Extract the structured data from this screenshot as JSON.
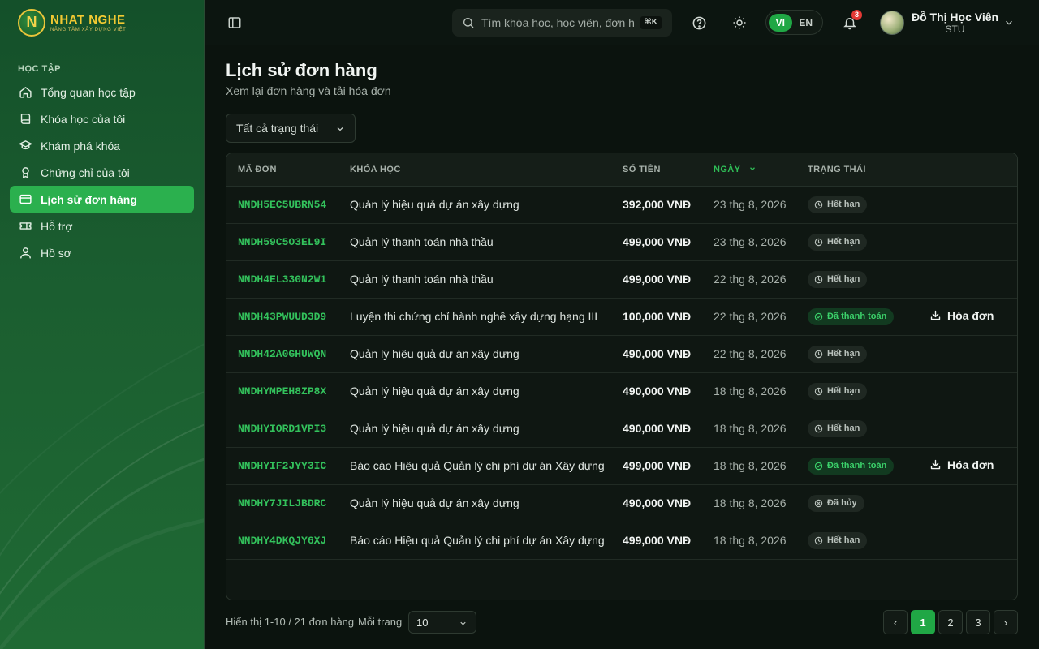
{
  "brand": {
    "name": "NHAT NGHE",
    "tagline": "NÂNG TẦM XÂY DỰNG VIỆT",
    "primary_color": "#20a745",
    "accent_color": "#f2c932"
  },
  "sidebar": {
    "section_label": "HỌC TẬP",
    "items": [
      {
        "label": "Tổng quan học tập",
        "icon": "home-icon",
        "active": false
      },
      {
        "label": "Khóa học của tôi",
        "icon": "book-icon",
        "active": false
      },
      {
        "label": "Khám phá khóa",
        "icon": "graduation-cap-icon",
        "active": false
      },
      {
        "label": "Chứng chỉ của tôi",
        "icon": "award-icon",
        "active": false
      },
      {
        "label": "Lịch sử đơn hàng",
        "icon": "credit-card-icon",
        "active": true
      },
      {
        "label": "Hỗ trợ",
        "icon": "ticket-icon",
        "active": false
      },
      {
        "label": "Hồ sơ",
        "icon": "user-icon",
        "active": false
      }
    ]
  },
  "header": {
    "search_placeholder": "Tìm khóa học, học viên, đơn h",
    "search_shortcut": "⌘K",
    "languages": [
      "VI",
      "EN"
    ],
    "active_language": "VI",
    "notification_count": "3",
    "user_name": "Đỗ Thị Học Viên",
    "user_role": "STU"
  },
  "main": {
    "title": "Lịch sử đơn hàng",
    "subtitle": "Xem lại đơn hàng và tải hóa đơn",
    "filter_value": "Tất cả trạng thái",
    "table": {
      "columns": [
        "MÃ ĐƠN",
        "KHÓA HỌC",
        "SỐ TIỀN",
        "NGÀY",
        "TRẠNG THÁI"
      ],
      "sorted_column": "NGÀY",
      "invoice_label": "Hóa đơn",
      "rows": [
        {
          "code": "NNDH5EC5UBRN54",
          "course": "Quản lý hiệu quả dự án xây dựng",
          "amount": "392,000 VNĐ",
          "date": "23 thg 8, 2026",
          "status": "Hết hạn",
          "status_type": "expired",
          "has_invoice": false
        },
        {
          "code": "NNDH59C5O3EL9I",
          "course": "Quản lý thanh toán nhà thầu",
          "amount": "499,000 VNĐ",
          "date": "23 thg 8, 2026",
          "status": "Hết hạn",
          "status_type": "expired",
          "has_invoice": false
        },
        {
          "code": "NNDH4EL330N2W1",
          "course": "Quản lý thanh toán nhà thầu",
          "amount": "499,000 VNĐ",
          "date": "22 thg 8, 2026",
          "status": "Hết hạn",
          "status_type": "expired",
          "has_invoice": false
        },
        {
          "code": "NNDH43PWUUD3D9",
          "course": "Luyện thi chứng chỉ hành nghề xây dựng hạng III",
          "amount": "100,000 VNĐ",
          "date": "22 thg 8, 2026",
          "status": "Đã thanh toán",
          "status_type": "paid",
          "has_invoice": true
        },
        {
          "code": "NNDH42A0GHUWQN",
          "course": "Quản lý hiệu quả dự án xây dựng",
          "amount": "490,000 VNĐ",
          "date": "22 thg 8, 2026",
          "status": "Hết hạn",
          "status_type": "expired",
          "has_invoice": false
        },
        {
          "code": "NNDHYMPEH8ZP8X",
          "course": "Quản lý hiệu quả dự án xây dựng",
          "amount": "490,000 VNĐ",
          "date": "18 thg 8, 2026",
          "status": "Hết hạn",
          "status_type": "expired",
          "has_invoice": false
        },
        {
          "code": "NNDHYIORD1VPI3",
          "course": "Quản lý hiệu quả dự án xây dựng",
          "amount": "490,000 VNĐ",
          "date": "18 thg 8, 2026",
          "status": "Hết hạn",
          "status_type": "expired",
          "has_invoice": false
        },
        {
          "code": "NNDHYIF2JYY3IC",
          "course": "Báo cáo Hiệu quả Quản lý chi phí dự án Xây dựng",
          "amount": "499,000 VNĐ",
          "date": "18 thg 8, 2026",
          "status": "Đã thanh toán",
          "status_type": "paid",
          "has_invoice": true
        },
        {
          "code": "NNDHY7JILJBDRC",
          "course": "Quản lý hiệu quả dự án xây dựng",
          "amount": "490,000 VNĐ",
          "date": "18 thg 8, 2026",
          "status": "Đã hủy",
          "status_type": "cancelled",
          "has_invoice": false
        },
        {
          "code": "NNDHY4DKQJY6XJ",
          "course": "Báo cáo Hiệu quả Quản lý chi phí dự án Xây dựng",
          "amount": "499,000 VNĐ",
          "date": "18 thg 8, 2026",
          "status": "Hết hạn",
          "status_type": "expired",
          "has_invoice": false
        }
      ]
    }
  },
  "pagination": {
    "summary": "Hiển thị 1-10 / 21 đơn hàng",
    "per_page_label": "Mỗi trang",
    "per_page_value": "10",
    "prev": "‹",
    "next": "›",
    "pages": [
      "1",
      "2",
      "3"
    ],
    "current_page": "1"
  }
}
